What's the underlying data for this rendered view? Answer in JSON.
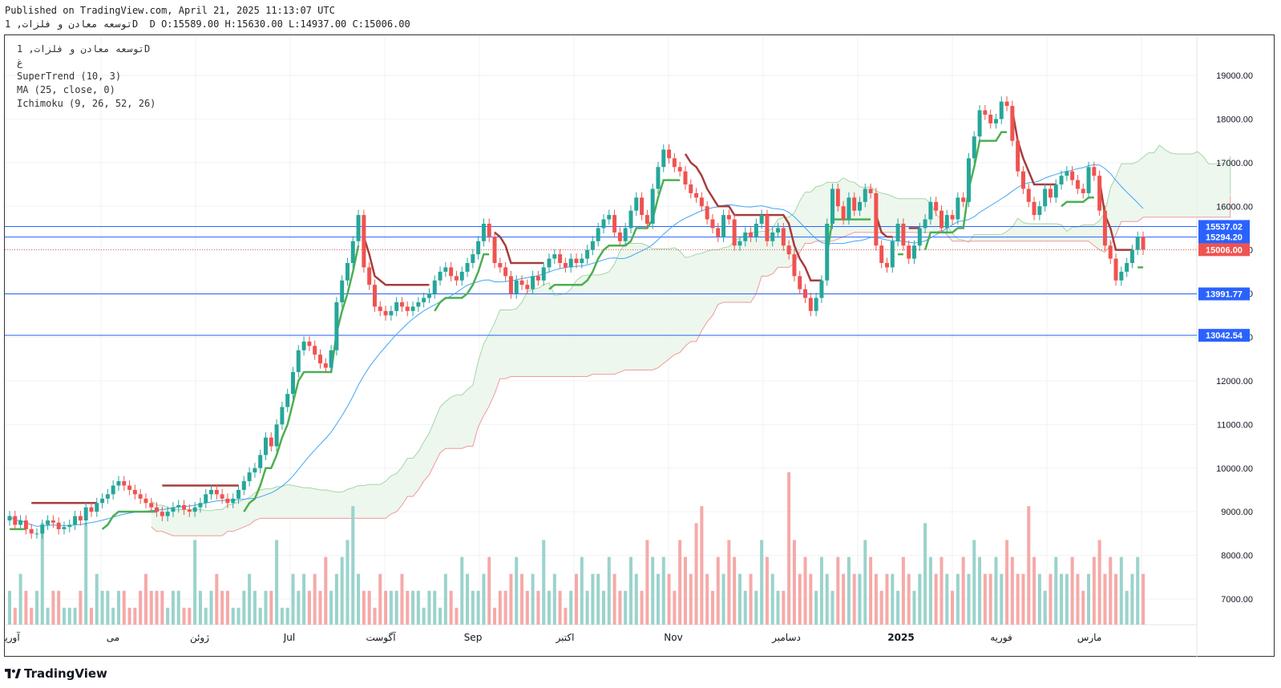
{
  "header": {
    "published_line": "Published on TradingView.com, April 21, 2025 11:13:07 UTC",
    "ohlc_line": "توسعه معادن و فلزات, 1D  D O:15589.00 H:15630.00 L:14937.00 C:15006.00"
  },
  "legend": {
    "symbol_line": "توسعه معادن و فلزات, 1D",
    "symbol_sub": "غ",
    "indicators": [
      "SuperTrend (10, 3)",
      "MA (25, close, 0)",
      "Ichimoku (9, 26, 52, 26)"
    ]
  },
  "footer": {
    "brand": "TradingView"
  },
  "colors": {
    "up": "#26a69a",
    "down": "#ef5350",
    "line_blue": "#2962ff",
    "ma": "#42a5f5",
    "st_up": "#4caf50",
    "st_down": "#a63d3d",
    "cloud_green": "#e8f5e9",
    "cloud_red": "#fde7e7"
  },
  "chart_data": {
    "type": "candlestick",
    "x_labels": [
      "آوریل",
      "می",
      "ژوئن",
      "Jul",
      "آگوست",
      "Sep",
      "اکتبر",
      "Nov",
      "دسامبر",
      "2025",
      "فوریه",
      "مارس"
    ],
    "y_ticks": [
      7000,
      8000,
      9000,
      10000,
      11000,
      12000,
      13000,
      14000,
      15000,
      16000,
      17000,
      18000,
      19000
    ],
    "price_labels": [
      {
        "value": 15537.02,
        "color": "#2962ff",
        "text": "15537.02"
      },
      {
        "value": 15294.2,
        "color": "#2962ff",
        "text": "15294.20"
      },
      {
        "value": 15006.0,
        "color": "#ef5350",
        "text": "15006.00"
      },
      {
        "value": 13991.77,
        "color": "#2962ff",
        "text": "13991.77"
      },
      {
        "value": 13042.54,
        "color": "#2962ff",
        "text": "13042.54"
      }
    ],
    "horizontal_lines": [
      15537.02,
      15294.2,
      13991.77,
      13042.54
    ],
    "last_price": 15006.0,
    "ohlc_last": {
      "open": 15589.0,
      "high": 15630.0,
      "low": 14937.0,
      "close": 15006.0
    },
    "close_series": [
      8900,
      8700,
      8800,
      8600,
      8500,
      8500,
      8700,
      8800,
      8750,
      8600,
      8650,
      8700,
      8900,
      8800,
      9100,
      9000,
      9200,
      9300,
      9400,
      9600,
      9700,
      9600,
      9500,
      9400,
      9300,
      9200,
      9100,
      9000,
      8900,
      9000,
      9100,
      9150,
      9050,
      9000,
      9100,
      9200,
      9400,
      9500,
      9400,
      9300,
      9200,
      9300,
      9500,
      9700,
      9900,
      10000,
      10300,
      10700,
      10500,
      11000,
      11400,
      11700,
      12200,
      12700,
      12900,
      12800,
      12600,
      12400,
      12300,
      12700,
      13800,
      14300,
      14700,
      15200,
      15800,
      14600,
      14200,
      13700,
      13600,
      13500,
      13600,
      13800,
      13700,
      13600,
      13700,
      13800,
      13900,
      14000,
      14300,
      14500,
      14600,
      14400,
      14300,
      14500,
      14700,
      14900,
      15200,
      15600,
      15300,
      14700,
      14600,
      14400,
      14000,
      14300,
      14200,
      14100,
      14400,
      14300,
      14600,
      14800,
      14900,
      14700,
      14600,
      14800,
      14700,
      14800,
      15000,
      15200,
      15500,
      15700,
      15800,
      15400,
      15200,
      15500,
      15900,
      16200,
      15800,
      15600,
      16400,
      16900,
      17300,
      17100,
      16900,
      16800,
      16500,
      16300,
      16200,
      16000,
      15700,
      15500,
      15300,
      15800,
      15700,
      15100,
      15200,
      15400,
      15300,
      15600,
      15800,
      15200,
      15400,
      15500,
      15100,
      14900,
      14400,
      14100,
      13900,
      13600,
      13900,
      14300,
      15600,
      16400,
      16000,
      15700,
      16200,
      15900,
      16100,
      16400,
      16300,
      15100,
      14700,
      14600,
      15200,
      15600,
      15100,
      14800,
      15100,
      15500,
      15700,
      16100,
      15900,
      15500,
      15800,
      15700,
      16200,
      16100,
      17100,
      17600,
      18200,
      18100,
      17900,
      18000,
      18400,
      18300,
      17500,
      16800,
      16400,
      16100,
      15800,
      16000,
      16400,
      16200,
      16500,
      16700,
      16800,
      16600,
      16400,
      16300,
      16900,
      16700,
      15900,
      15100,
      14800,
      14300,
      14500,
      14700,
      15000,
      15300,
      15006
    ],
    "ma_series_note": "MA 25 computed from close_series",
    "volume_scale_note": "relative volumes",
    "volumes": [
      2,
      1,
      3,
      2,
      1,
      2,
      6,
      1,
      2,
      2,
      1,
      1,
      1,
      2,
      6,
      1,
      3,
      2,
      2,
      1,
      2,
      2,
      1,
      1,
      2,
      3,
      2,
      2,
      2,
      1,
      2,
      2,
      1,
      1,
      5,
      2,
      1,
      2,
      3,
      2,
      2,
      1,
      1,
      2,
      3,
      2,
      1,
      2,
      2,
      5,
      1,
      1,
      3,
      2,
      3,
      2,
      3,
      2,
      4,
      2,
      3,
      4,
      5,
      7,
      3,
      2,
      2,
      1,
      3,
      2,
      2,
      2,
      3,
      2,
      2,
      2,
      1,
      2,
      2,
      1,
      3,
      2,
      1,
      4,
      3,
      2,
      2,
      3,
      4,
      1,
      2,
      2,
      3,
      4,
      3,
      2,
      3,
      2,
      5,
      2,
      3,
      2,
      1,
      2,
      3,
      4,
      2,
      3,
      3,
      2,
      4,
      3,
      2,
      2,
      4,
      3,
      2,
      5,
      4,
      3,
      4,
      3,
      2,
      5,
      4,
      3,
      6,
      7,
      3,
      2,
      4,
      3,
      5,
      4,
      3,
      2,
      3,
      2,
      5,
      4,
      3,
      2,
      2,
      9,
      5,
      3,
      4,
      3,
      2,
      4,
      3,
      2,
      4,
      3,
      4,
      3,
      3,
      5,
      4,
      3,
      2,
      3,
      3,
      2,
      4,
      3,
      2,
      3,
      6,
      4,
      3,
      4,
      3,
      2,
      3,
      4,
      3,
      5,
      4,
      3,
      3,
      4,
      3,
      5,
      4,
      3,
      3,
      7,
      4,
      3,
      2,
      3,
      4,
      3,
      3,
      4,
      3,
      2,
      3,
      4,
      5,
      3,
      4,
      3,
      4,
      2,
      3,
      4,
      3
    ]
  }
}
